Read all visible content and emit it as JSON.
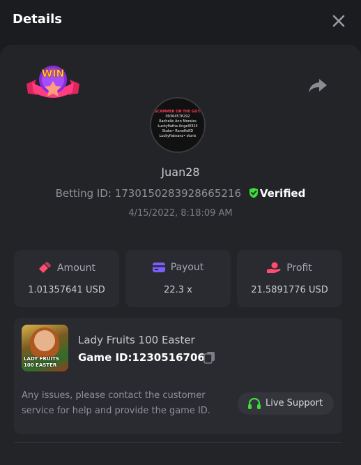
{
  "header": {
    "title": "Details"
  },
  "player": {
    "username": "Juan28",
    "betting_id_label": "Betting ID:",
    "betting_id": "1730150283928665216",
    "verified_label": "Verified",
    "date": "4/15/2022, 8:18:09 AM",
    "avatar_lines": [
      "SCAMMER ON THE GO!!",
      "09364576292",
      "Rachelle Ann Morales",
      "Luckyfiatha Angel0314",
      "Stake• RanolfoKD",
      "Luckyfiatnanz• storis"
    ],
    "badge_text": "WIN"
  },
  "stats": {
    "amount": {
      "label": "Amount",
      "value": "1.01357641 USD",
      "color": "#ff4d6d"
    },
    "payout": {
      "label": "Payout",
      "value": "22.3 x",
      "color": "#7b5cff"
    },
    "profit": {
      "label": "Profit",
      "value": "21.5891776 USD",
      "color": "#ff4d6d"
    }
  },
  "game": {
    "name": "Lady Fruits 100 Easter",
    "id_label": "Game ID:",
    "id": "12305167068",
    "thumb_title_1": "LADY FRUITS",
    "thumb_title_2": "100 EASTER"
  },
  "support": {
    "note": "Any issues, please contact the customer service for help and provide the game ID.",
    "button_label": "Live Support",
    "icon_color": "#3ddc3a"
  },
  "colors": {
    "verified": "#3ddc3a",
    "background": "#1b1c1f",
    "card": "#232428",
    "panel": "#2a2b30"
  }
}
